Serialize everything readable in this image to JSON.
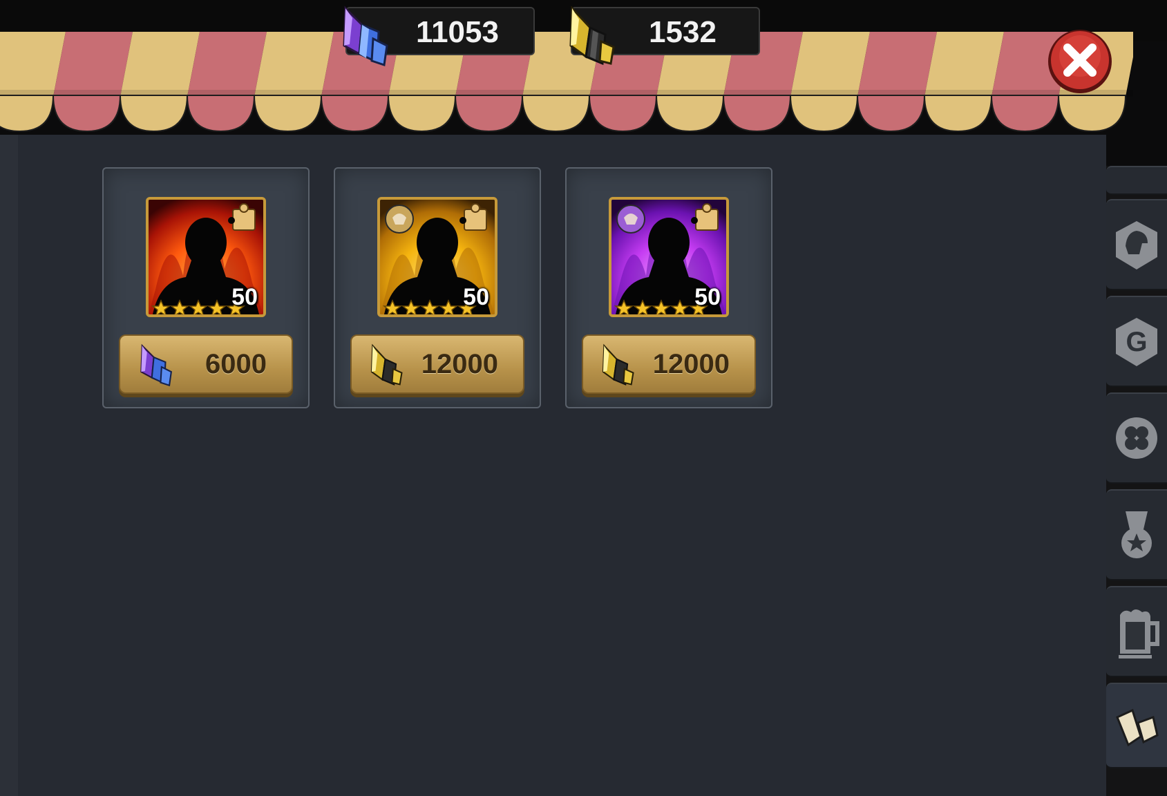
{
  "currencies": [
    {
      "icon": "purple-blue-crystal-icon",
      "value": "11053"
    },
    {
      "icon": "gold-crystal-icon",
      "value": "1532"
    }
  ],
  "close_icon": "close-icon",
  "shop_items": [
    {
      "flame_color": "red",
      "emblem_icon": "",
      "puzzle_icon": "puzzle-piece-icon",
      "stars": 5,
      "level": "50",
      "price_currency_icon": "purple-blue-crystal-icon",
      "price": "6000"
    },
    {
      "flame_color": "gold",
      "emblem_icon": "wing-emblem-icon",
      "puzzle_icon": "puzzle-piece-icon",
      "stars": 5,
      "level": "50",
      "price_currency_icon": "gold-crystal-icon",
      "price": "12000"
    },
    {
      "flame_color": "purple",
      "emblem_icon": "demon-emblem-icon",
      "puzzle_icon": "puzzle-piece-icon",
      "stars": 5,
      "level": "50",
      "price_currency_icon": "gold-crystal-icon",
      "price": "12000"
    }
  ],
  "side_tabs": [
    {
      "icon": "helmet-icon",
      "active": false
    },
    {
      "icon": "guild-g-icon",
      "active": false
    },
    {
      "icon": "clover-icon",
      "active": false
    },
    {
      "icon": "medal-icon",
      "active": false
    },
    {
      "icon": "beer-mug-icon",
      "active": false
    },
    {
      "icon": "crystal-shard-icon",
      "active": true
    }
  ],
  "colors": {
    "awning_red": "#c86e74",
    "awning_tan": "#e0c27c",
    "panel_bg": "#262a32",
    "button_gold": "#c9a55c",
    "close_red": "#c8342e"
  }
}
